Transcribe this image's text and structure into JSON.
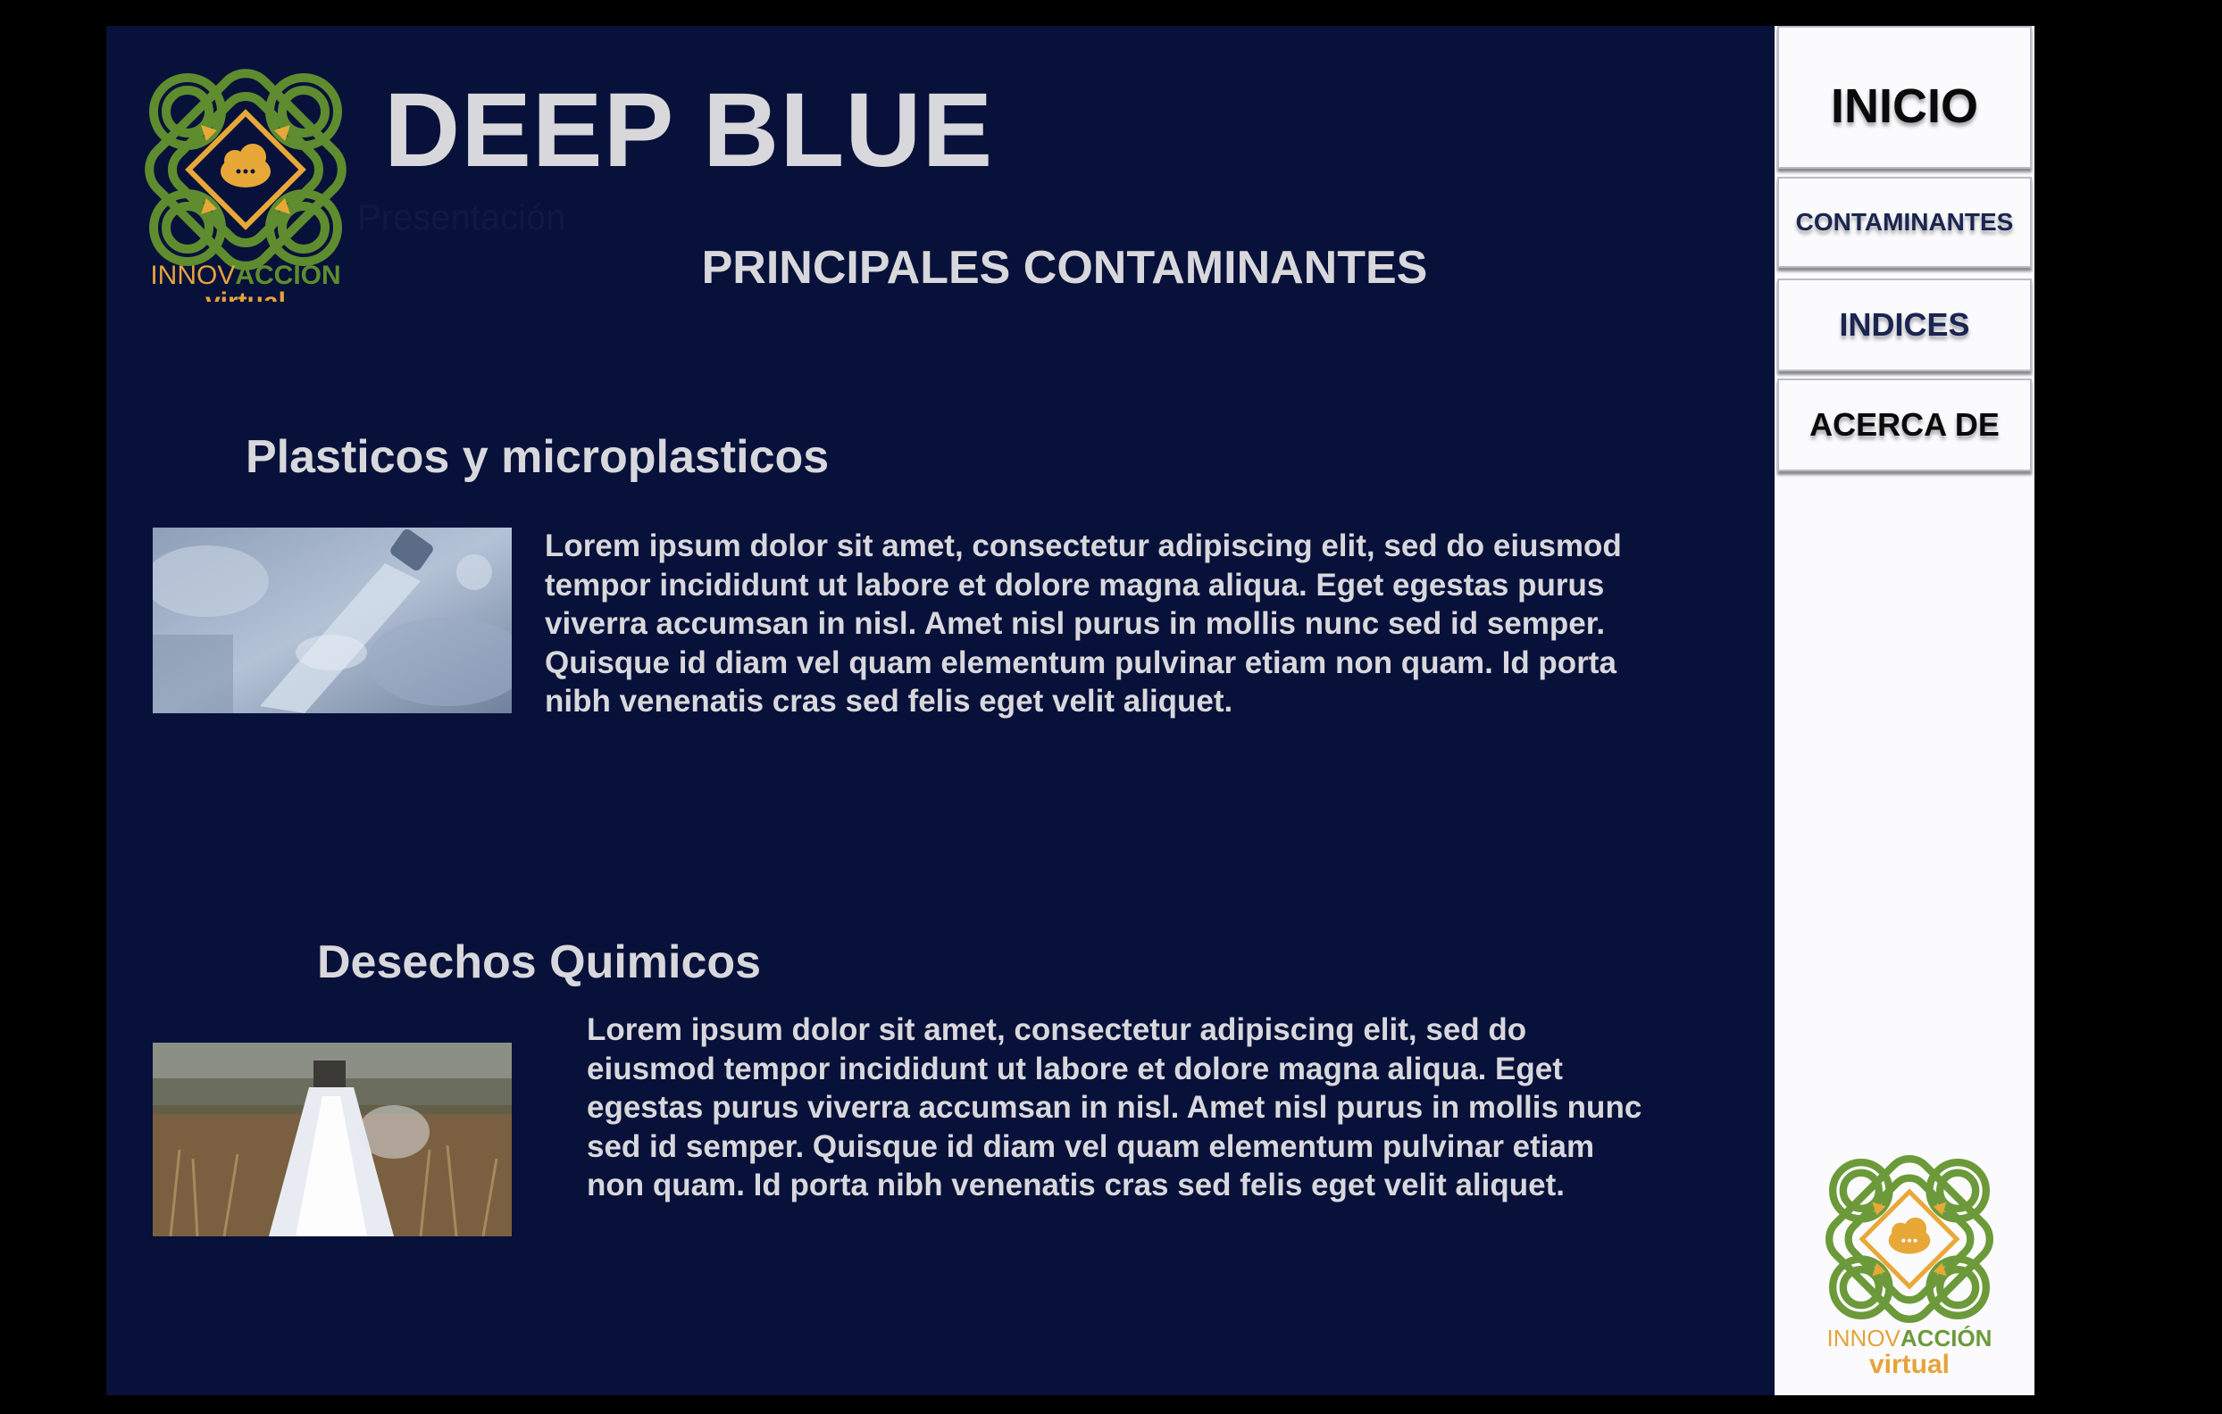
{
  "header": {
    "brand": "DEEP BLUE",
    "faint_text": "Presentación"
  },
  "logo": {
    "name_light": "INNOV",
    "name_bold": "ACCIÓN",
    "sub": "virtual",
    "colors": {
      "green": "#5e8c2e",
      "gold": "#e8a838",
      "gold_text": "#e6a33a"
    }
  },
  "page": {
    "title": "PRINCIPALES CONTAMINANTES"
  },
  "sections": [
    {
      "title": "Plasticos y microplasticos",
      "text": "Lorem ipsum dolor sit amet, consectetur adipiscing elit, sed do eiusmod tempor incididunt ut labore et dolore magna aliqua. Eget egestas purus viverra accumsan in nisl. Amet nisl purus in mollis nunc sed id semper. Quisque id diam vel quam elementum pulvinar etiam non quam. Id porta nibh venenatis cras sed felis eget velit aliquet.",
      "image": "plastic-bottles-photo"
    },
    {
      "title": "Desechos Quimicos",
      "text": "Lorem ipsum dolor sit amet, consectetur adipiscing elit, sed do eiusmod tempor incididunt ut labore et dolore magna aliqua. Eget egestas purus viverra accumsan in nisl. Amet nisl purus in mollis nunc sed id semper. Quisque id diam vel quam elementum pulvinar etiam non quam. Id porta nibh venenatis cras sed felis eget velit aliquet.",
      "image": "chemical-discharge-pipe-photo"
    }
  ],
  "nav": {
    "items": [
      {
        "label": "INICIO",
        "color": "#0a0a0a"
      },
      {
        "label": "CONTAMINANTES",
        "color": "#1a2550"
      },
      {
        "label": "INDICES",
        "color": "#1a2550"
      },
      {
        "label": "ACERCA DE",
        "color": "#0a0a0a"
      }
    ]
  },
  "colors": {
    "background": "#000000",
    "panel": "#08113a",
    "sidebar": "#fbfbfe",
    "text": "#d8d8dc"
  }
}
